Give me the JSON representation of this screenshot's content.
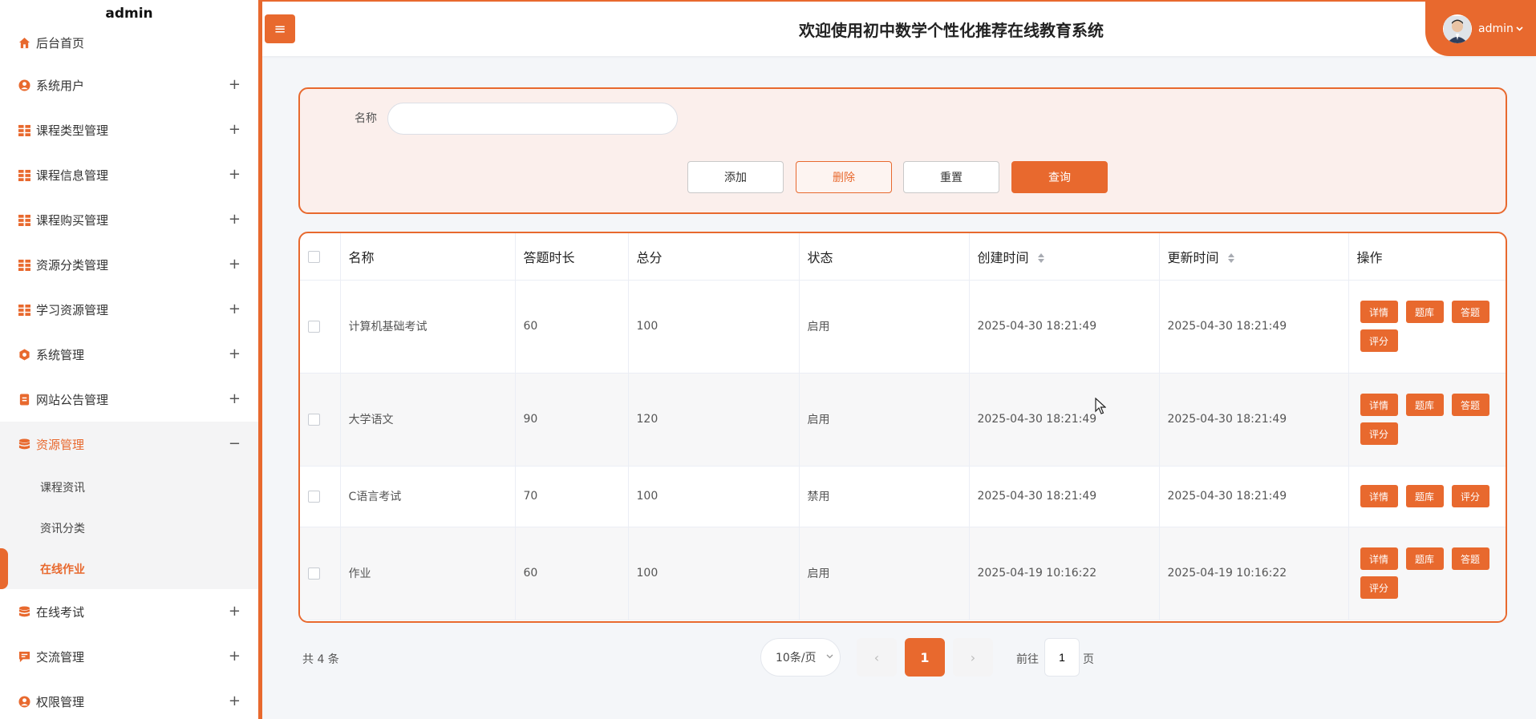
{
  "sidebar": {
    "brand": "admin",
    "items": [
      {
        "label": "后台首页",
        "icon": "home-icon"
      },
      {
        "label": "系统用户",
        "icon": "user-icon"
      },
      {
        "label": "课程类型管理",
        "icon": "grid-icon"
      },
      {
        "label": "课程信息管理",
        "icon": "grid-icon"
      },
      {
        "label": "课程购买管理",
        "icon": "grid-icon"
      },
      {
        "label": "资源分类管理",
        "icon": "grid-icon"
      },
      {
        "label": "学习资源管理",
        "icon": "grid-icon"
      },
      {
        "label": "系统管理",
        "icon": "gear-icon"
      },
      {
        "label": "网站公告管理",
        "icon": "document-icon"
      },
      {
        "label": "资源管理",
        "icon": "database-icon"
      },
      {
        "label": "在线考试",
        "icon": "database-icon"
      },
      {
        "label": "交流管理",
        "icon": "chat-icon"
      },
      {
        "label": "权限管理",
        "icon": "user-icon"
      }
    ],
    "submenu": [
      "课程资讯",
      "资讯分类",
      "在线作业"
    ],
    "plus": "+",
    "minus": "−"
  },
  "header": {
    "title": "欢迎使用初中数学个性化推荐在线教育系统",
    "user": "admin",
    "menu_icon": "≡"
  },
  "search": {
    "label": "名称",
    "value": "",
    "buttons": {
      "add": "添加",
      "delete": "删除",
      "reset": "重置",
      "query": "查询"
    }
  },
  "table": {
    "columns": [
      "名称",
      "答题时长",
      "总分",
      "状态",
      "创建时间",
      "更新时间",
      "操作"
    ],
    "rows": [
      {
        "name": "计算机基础考试",
        "duration": "60",
        "score": "100",
        "status": "启用",
        "created": "2025-04-30 18:21:49",
        "updated": "2025-04-30 18:21:49",
        "ops": [
          "详情",
          "题库",
          "答题",
          "评分"
        ]
      },
      {
        "name": "大学语文",
        "duration": "90",
        "score": "120",
        "status": "启用",
        "created": "2025-04-30 18:21:49",
        "updated": "2025-04-30 18:21:49",
        "ops": [
          "详情",
          "题库",
          "答题",
          "评分"
        ]
      },
      {
        "name": "C语言考试",
        "duration": "70",
        "score": "100",
        "status": "禁用",
        "created": "2025-04-30 18:21:49",
        "updated": "2025-04-30 18:21:49",
        "ops": [
          "详情",
          "题库",
          "评分"
        ]
      },
      {
        "name": "作业",
        "duration": "60",
        "score": "100",
        "status": "启用",
        "created": "2025-04-19 10:16:22",
        "updated": "2025-04-19 10:16:22",
        "ops": [
          "详情",
          "题库",
          "答题",
          "评分"
        ]
      }
    ]
  },
  "pagination": {
    "total": "共 4 条",
    "page_size": "10条/页",
    "current": "1",
    "goto_prefix": "前往",
    "goto_value": "1",
    "goto_suffix": "页",
    "prev": "‹",
    "next": "›"
  },
  "colors": {
    "accent": "#e8692e"
  }
}
